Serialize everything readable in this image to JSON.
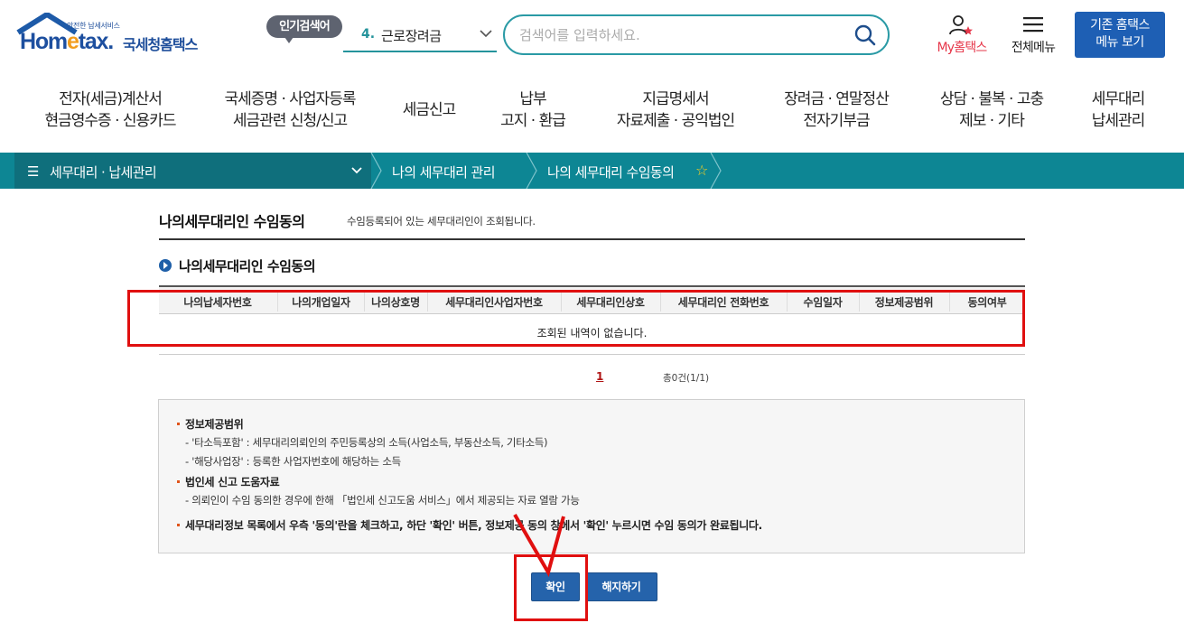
{
  "header": {
    "logo_small": "안전한 납세서비스",
    "logo_word_a": "Hom",
    "logo_word_e": "e",
    "logo_word_b": "tax.",
    "logo_kr": "국세청홈택스",
    "popular_badge": "인기검색어",
    "popular_rank": "4.",
    "popular_term": "근로장려금",
    "search_placeholder": "검색어를 입력하세요.",
    "my_hometax_a": "My",
    "my_hometax_b": "홈택스",
    "full_menu": "전체메뉴",
    "old_menu_line1": "기존 홈택스",
    "old_menu_line2": "메뉴 보기"
  },
  "gnb": [
    {
      "line1": "전자(세금)계산서",
      "line2": "현금영수증 · 신용카드"
    },
    {
      "line1": "국세증명 · 사업자등록",
      "line2": "세금관련 신청/신고"
    },
    {
      "line1": "세금신고",
      "line2": ""
    },
    {
      "line1": "납부",
      "line2": "고지 · 환급"
    },
    {
      "line1": "지급명세서",
      "line2": "자료제출 · 공익법인"
    },
    {
      "line1": "장려금 · 연말정산",
      "line2": "전자기부금"
    },
    {
      "line1": "상담 · 불복 · 고충",
      "line2": "제보 · 기타"
    },
    {
      "line1": "세무대리",
      "line2": "납세관리"
    }
  ],
  "breadcrumb": {
    "root": "세무대리 · 납세관리",
    "level2": "나의 세무대리 관리",
    "level3": "나의 세무대리 수임동의"
  },
  "page": {
    "title": "나의세무대리인 수임동의",
    "description": "수임등록되어 있는 세무대리인이 조회됩니다.",
    "section_title": "나의세무대리인 수임동의"
  },
  "table": {
    "columns": [
      "나의납세자번호",
      "나의개업일자",
      "나의상호명",
      "세무대리인사업자번호",
      "세무대리인상호",
      "세무대리인 전화번호",
      "수임일자",
      "정보제공범위",
      "동의여부"
    ],
    "empty_message": "조회된 내역이 없습니다."
  },
  "pagination": {
    "current_page": "1",
    "total": "총0건(1/1)"
  },
  "info": {
    "h1": "정보제공범위",
    "l1": "- '타소득포함' : 세무대리의뢰인의 주민등록상의 소득(사업소득, 부동산소득, 기타소득)",
    "l2": "- '해당사업장' : 등록한 사업자번호에 해당하는 소득",
    "h2": "법인세 신고 도움자료",
    "l3": "- 의뢰인이 수임 동의한 경우에 한해 「법인세 신고도움 서비스」에서 제공되는 자료 열람 가능",
    "h3": "세무대리정보 목록에서 우측 '동의'란을 체크하고, 하단 '확인' 버튼, 정보제공 동의 창에서 '확인' 누르시면 수임 동의가 완료됩니다."
  },
  "buttons": {
    "confirm": "확인",
    "cancel": "해지하기"
  },
  "colors": {
    "brand_blue": "#1d4f9f",
    "teal": "#0d8694",
    "teal_dark": "#0f6f7c",
    "button_blue": "#2563ab",
    "annotation_red": "#e00f0f"
  }
}
